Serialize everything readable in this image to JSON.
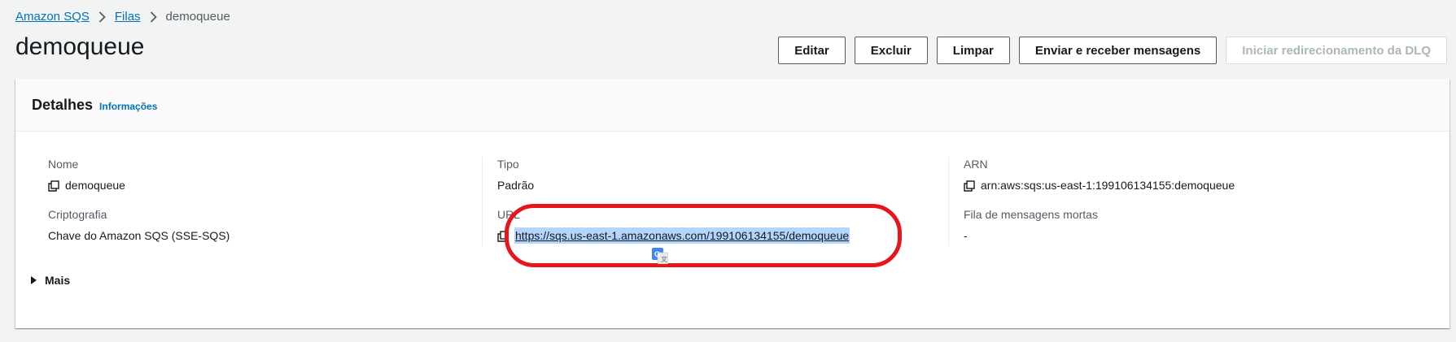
{
  "breadcrumb": {
    "items": [
      {
        "label": "Amazon SQS"
      },
      {
        "label": "Filas"
      },
      {
        "label": "demoqueue"
      }
    ]
  },
  "page": {
    "title": "demoqueue"
  },
  "actions": {
    "edit": "Editar",
    "delete": "Excluir",
    "purge": "Limpar",
    "send_receive": "Enviar e receber mensagens",
    "dlq_redrive": "Iniciar redirecionamento da DLQ"
  },
  "details": {
    "title": "Detalhes",
    "info_link": "Informações",
    "name": {
      "label": "Nome",
      "value": "demoqueue"
    },
    "type": {
      "label": "Tipo",
      "value": "Padrão"
    },
    "arn": {
      "label": "ARN",
      "value": "arn:aws:sqs:us-east-1:199106134155:demoqueue"
    },
    "encryption": {
      "label": "Criptografia",
      "value": "Chave do Amazon SQS (SSE-SQS)"
    },
    "url": {
      "label": "URL",
      "value": "https://sqs.us-east-1.amazonaws.com/199106134155/demoqueue"
    },
    "dlq": {
      "label": "Fila de mensagens mortas",
      "value": "-"
    },
    "more": "Mais"
  },
  "icons": {
    "copy": "copy-icon",
    "chevron": "chevron-right-icon",
    "caret": "caret-right-icon",
    "translate": "google-translate-icon"
  },
  "colors": {
    "link": "#0073bb",
    "highlight": "#e8161b",
    "selection": "#b4d5fe",
    "background": "#f2f3f3"
  }
}
